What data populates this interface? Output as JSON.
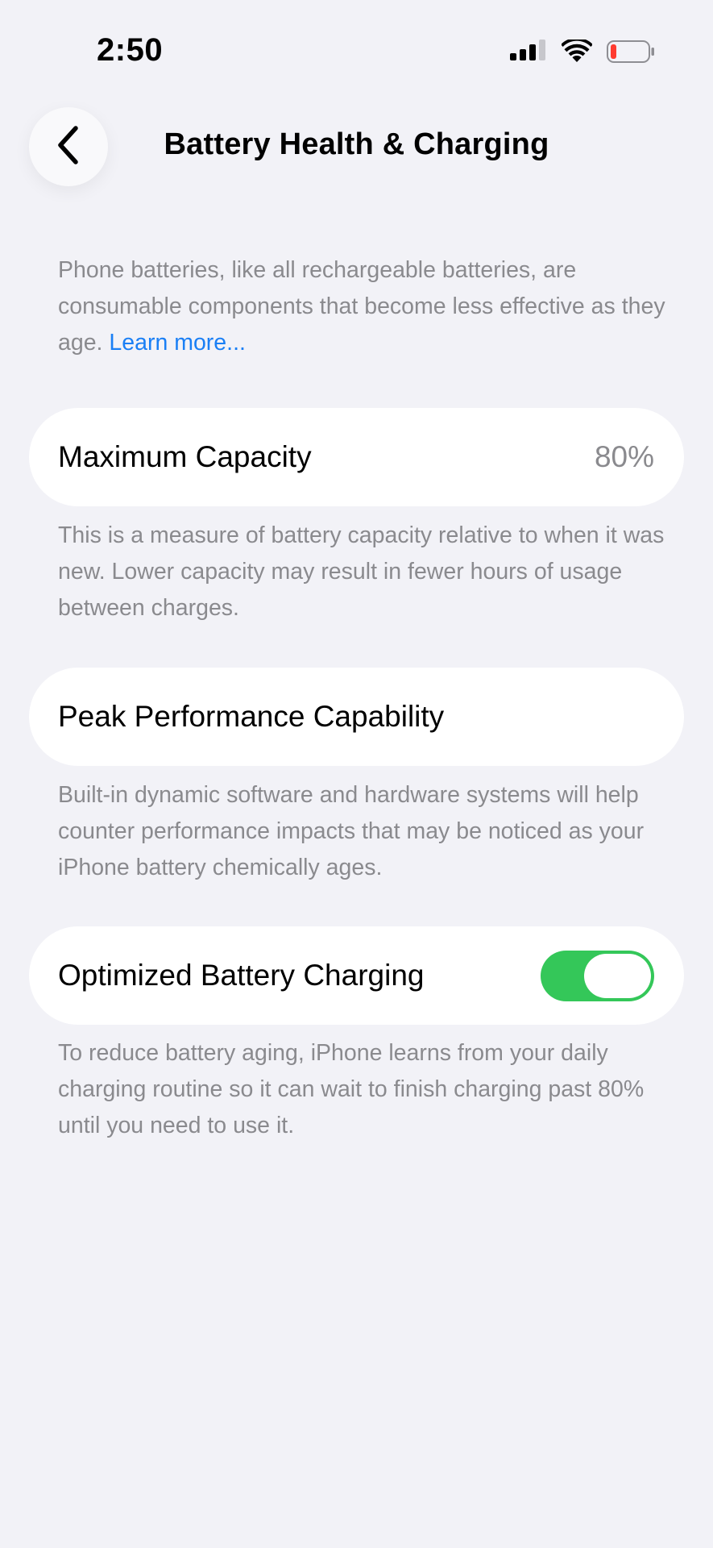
{
  "status_bar": {
    "time": "2:50",
    "icons": [
      "cellular-signal-icon",
      "wifi-icon",
      "battery-low-icon"
    ],
    "battery_color": "#ff3b30"
  },
  "nav": {
    "title": "Battery Health & Charging",
    "back_icon": "chevron-left-icon"
  },
  "intro": {
    "text": "Phone batteries, like all rechargeable batteries, are consumable components that become less effective as they age.",
    "link": "Learn more..."
  },
  "maximum_capacity": {
    "label": "Maximum Capacity",
    "value": "80%",
    "footnote": "This is a measure of battery capacity relative to when it was new. Lower capacity may result in fewer hours of usage between charges."
  },
  "peak_performance": {
    "label": "Peak Performance Capability",
    "footnote": "Built-in dynamic software and hardware systems will help counter performance impacts that may be noticed as your iPhone battery chemically ages."
  },
  "optimized_charging": {
    "label": "Optimized Battery Charging",
    "enabled": true,
    "toggle_color": "#34c759",
    "footnote": "To reduce battery aging, iPhone learns from your daily charging routine so it can wait to finish charging past 80% until you need to use it."
  },
  "colors": {
    "background": "#f2f2f7",
    "secondary_text": "#8a8a8e",
    "link": "#1a7ff5"
  }
}
